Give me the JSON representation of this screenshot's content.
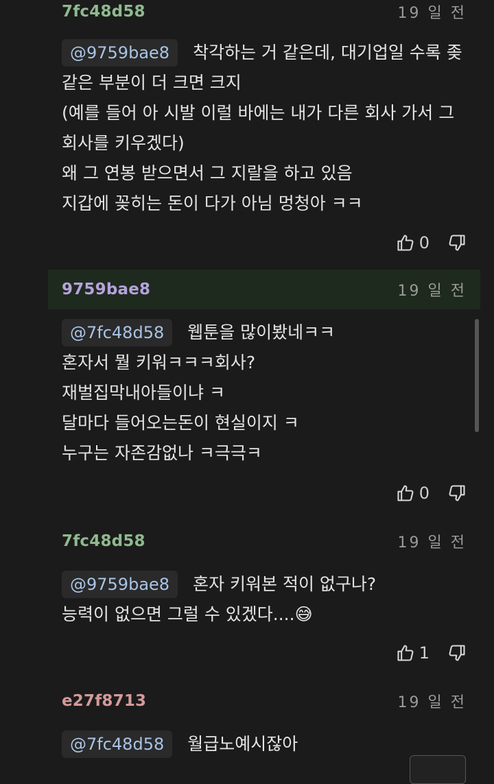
{
  "comments": [
    {
      "author": "7fc48d58",
      "author_color": "#8fb98f",
      "time": "19 일 전",
      "mention": "@9759bae8",
      "lines": [
        "착각하는 거 같은데, 대기업일 수록 좆",
        "같은 부분이 더 크면 크지",
        "(예를 들어 아 시발 이럴 바에는 내가 다른 회사 가서 그",
        "회사를 키우겠다)",
        "왜 그 연봉 받으면서 그 지랄을 하고 있음",
        "지갑에 꽂히는 돈이 다가 아님 멍청아 ㅋㅋ"
      ],
      "likes": "0"
    },
    {
      "author": "9759bae8",
      "author_color": "#b6a2dc",
      "time": "19 일 전",
      "mention": "@7fc48d58",
      "lines": [
        "웹툰을 많이봤네ㅋㅋ",
        "혼자서 뭘 키워ㅋㅋㅋ회사?",
        "재벌집막내아들이냐 ㅋ",
        "달마다 들어오는돈이 현실이지 ㅋ",
        "누구는 자존감없나 ㅋ극극ㅋ"
      ],
      "likes": "0"
    },
    {
      "author": "7fc48d58",
      "author_color": "#8fb98f",
      "time": "19 일 전",
      "mention": "@9759bae8",
      "lines": [
        "혼자 키워본 적이 없구나?",
        "능력이 없으면 그럴 수 있겠다....😅"
      ],
      "likes": "1"
    },
    {
      "author": "e27f8713",
      "author_color": "#d49a9a",
      "time": "19 일 전",
      "mention": "@7fc48d58",
      "lines": [
        "월급노예시잖아"
      ]
    }
  ],
  "icons": {
    "like": "thumbs-up-icon",
    "dislike": "thumbs-down-icon"
  },
  "colors": {
    "mention": "#a9c4e6",
    "highlight_header": "#1e2a1e"
  }
}
